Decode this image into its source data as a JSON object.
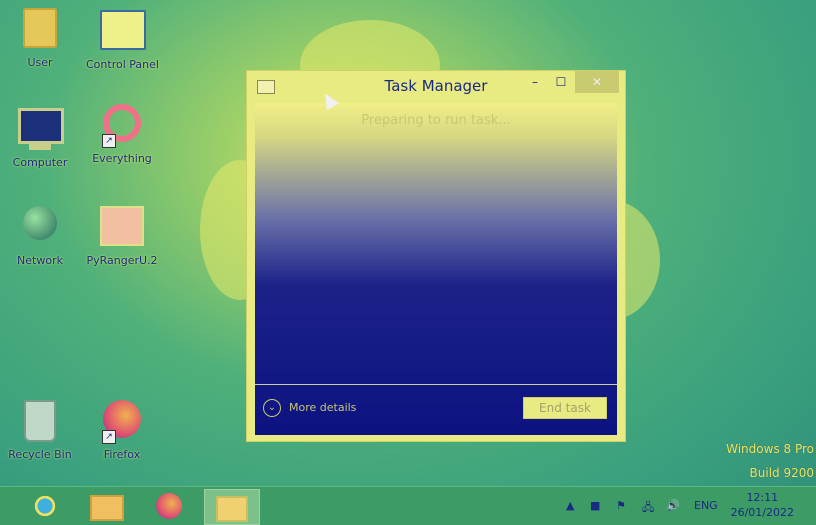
{
  "desktop": {
    "icons": [
      {
        "label": "User"
      },
      {
        "label": "Control Panel"
      },
      {
        "label": "Computer"
      },
      {
        "label": "Everything"
      },
      {
        "label": "Network"
      },
      {
        "label": "PyRangerU.2"
      },
      {
        "label": "Recycle Bin"
      },
      {
        "label": "Firefox"
      }
    ]
  },
  "task_manager": {
    "title": "Task Manager",
    "min_glyph": "–",
    "max_glyph": "☐",
    "close_glyph": "✕",
    "loading_text": "Preparing to run task...",
    "more_details": "More details",
    "end_task": "End task"
  },
  "watermark": {
    "line1": "Windows 8 Pro",
    "line2": "Build 9200"
  },
  "taskbar": {
    "language": "ENG",
    "time": "12:11",
    "date": "26/01/2022"
  },
  "colors": {
    "title_text": "#1a2a80",
    "window_frame": "#e8ea82",
    "taskbar": "#3d9c66"
  }
}
